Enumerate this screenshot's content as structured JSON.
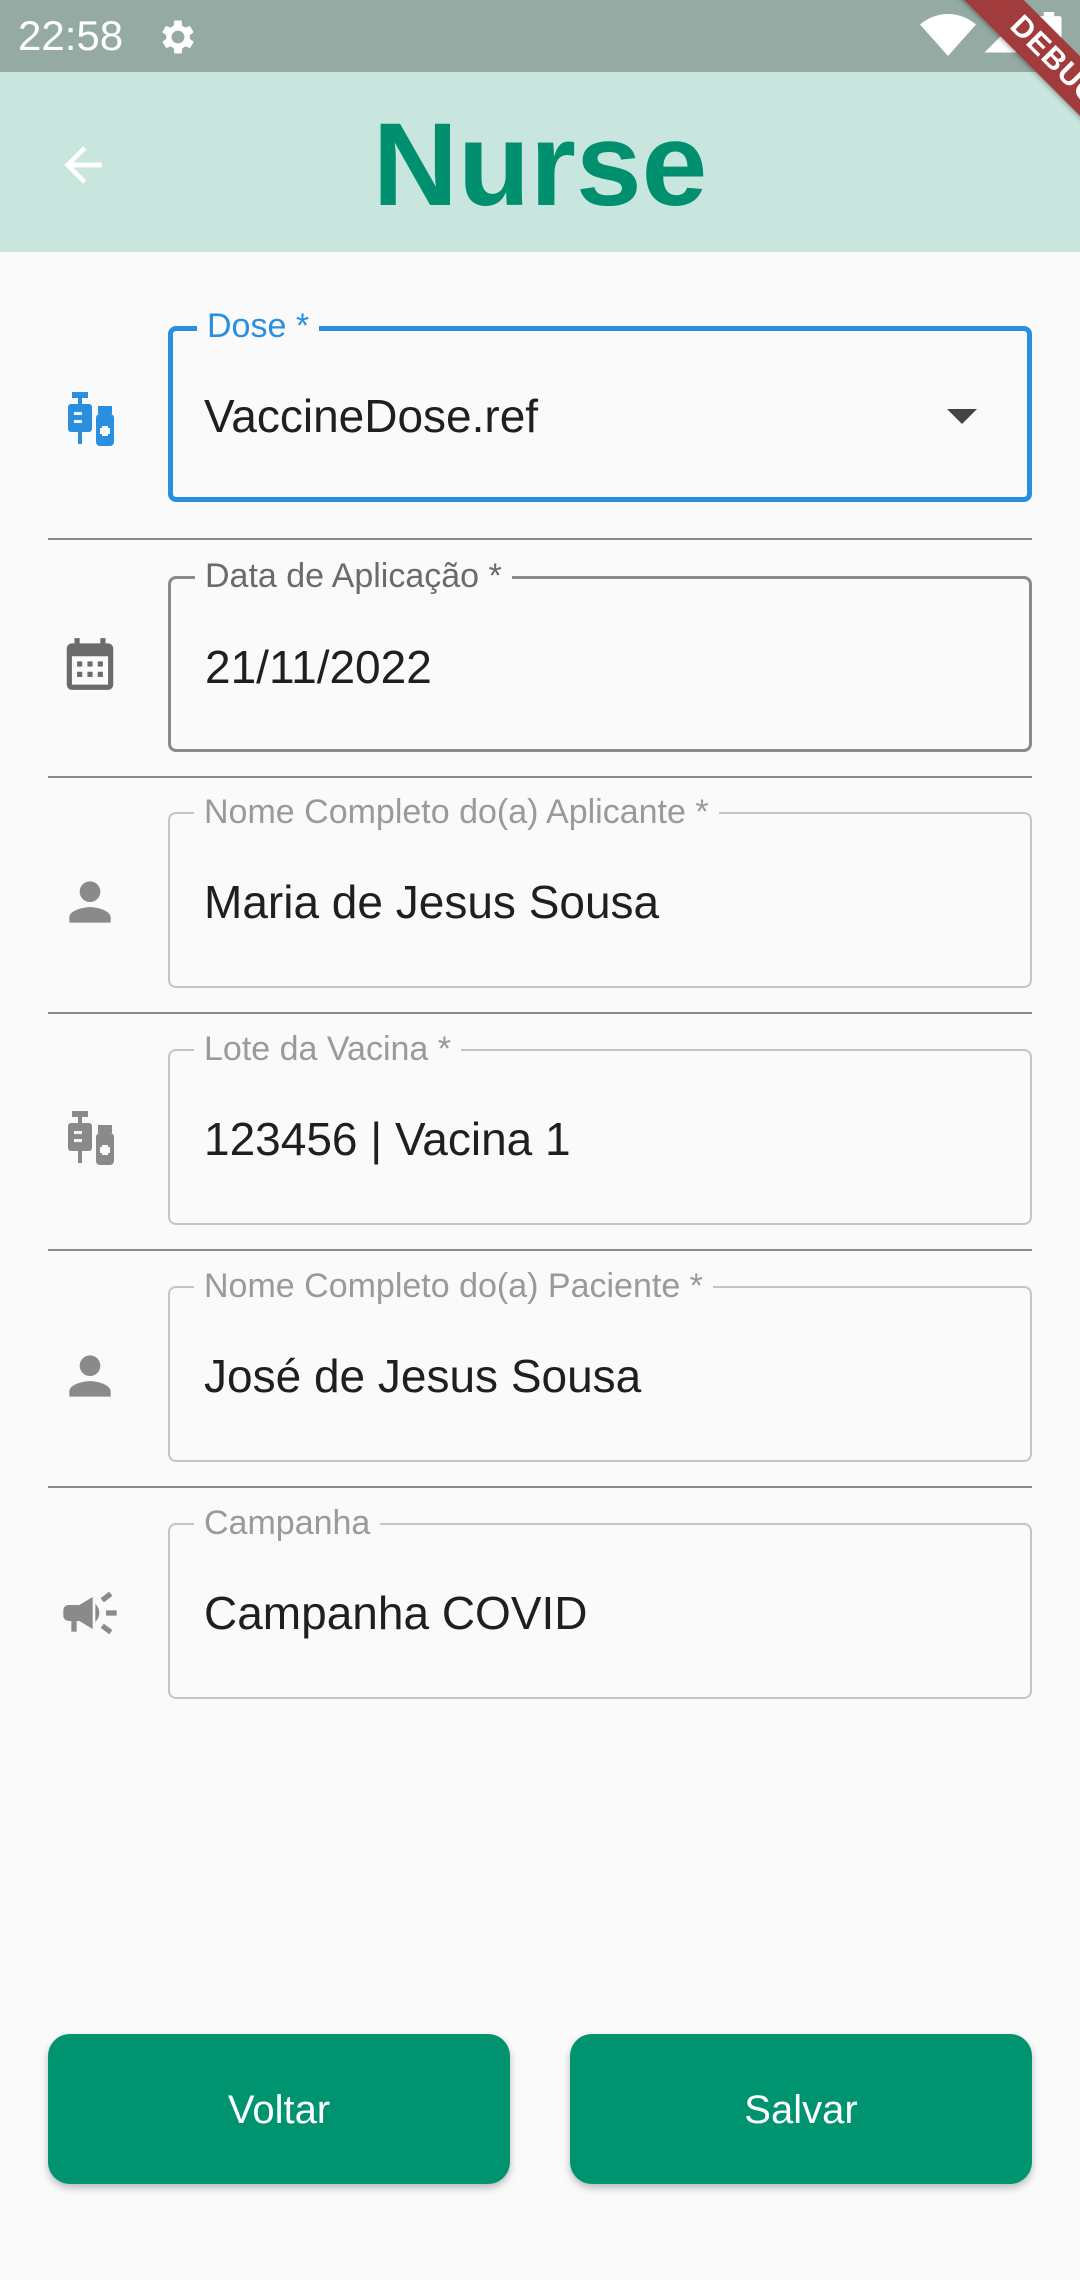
{
  "status_bar": {
    "time": "22:58",
    "icons": [
      "gear-icon",
      "wifi-icon",
      "signal-icon",
      "battery-icon"
    ]
  },
  "debug_banner": "DEBUG",
  "app_bar": {
    "title": "Nurse",
    "back_icon": "arrow-back-icon",
    "background": "#c9e6de",
    "title_color": "#00906f"
  },
  "form": {
    "fields": [
      {
        "label": "Dose *",
        "value": "VaccineDose.ref",
        "icon": "vaccine-icon",
        "type": "dropdown",
        "state": "focused"
      },
      {
        "label": "Data de Aplicação *",
        "value": "21/11/2022",
        "icon": "calendar-icon",
        "type": "date",
        "state": "enabled"
      },
      {
        "label": "Nome Completo do(a) Aplicante *",
        "value": "Maria de Jesus Sousa",
        "icon": "person-icon",
        "type": "text",
        "state": "disabled"
      },
      {
        "label": "Lote da Vacina *",
        "value": "123456 | Vacina 1",
        "icon": "vaccine-icon",
        "type": "text",
        "state": "disabled"
      },
      {
        "label": "Nome Completo do(a) Paciente *",
        "value": "José de Jesus Sousa",
        "icon": "person-icon",
        "type": "text",
        "state": "disabled"
      },
      {
        "label": "Campanha",
        "value": "Campanha COVID",
        "icon": "campaign-icon",
        "type": "text",
        "state": "disabled"
      }
    ]
  },
  "buttons": {
    "back_label": "Voltar",
    "save_label": "Salvar",
    "color": "#009370"
  },
  "colors": {
    "focus": "#2b8fe0",
    "icon_gray": "#8a8a8a"
  }
}
